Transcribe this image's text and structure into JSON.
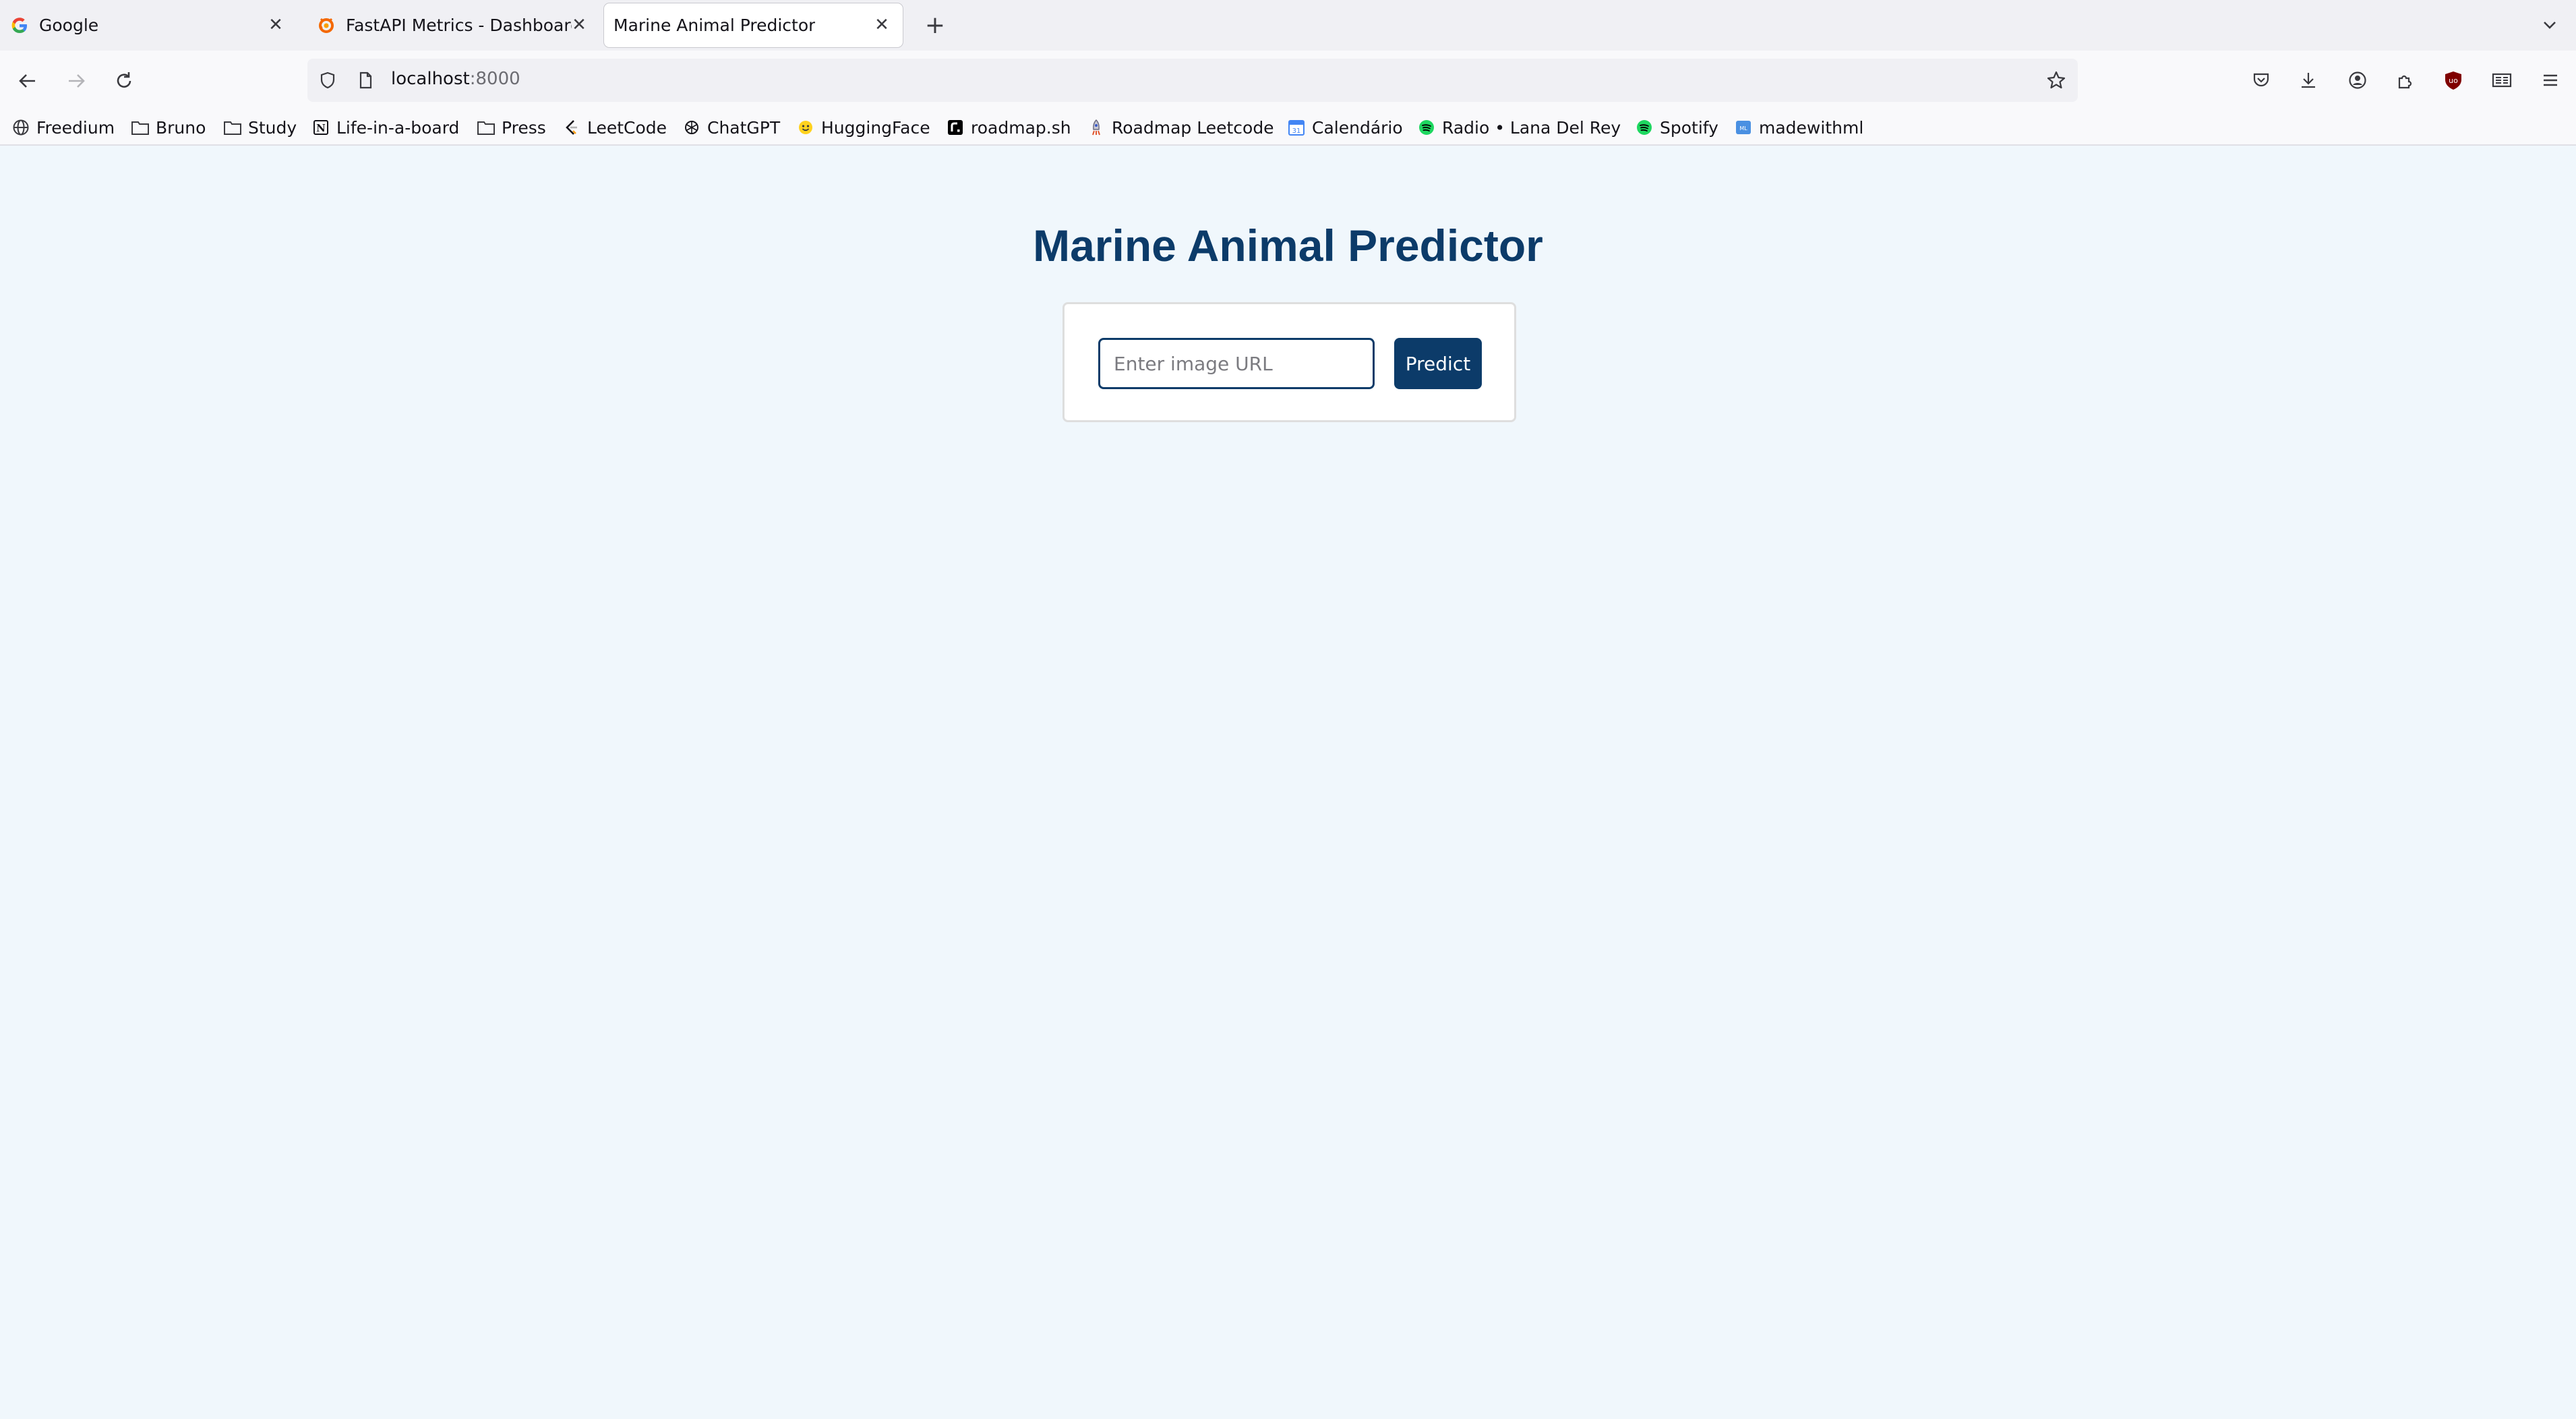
{
  "browser": {
    "tabs": [
      {
        "title": "Google",
        "favicon": "google-g-icon"
      },
      {
        "title": "FastAPI Metrics - Dashboard",
        "favicon": "grafana-icon"
      },
      {
        "title": "Marine Animal Predictor",
        "favicon": "none"
      }
    ],
    "url": {
      "host": "localhost",
      "port": ":8000"
    },
    "bookmarks": [
      {
        "label": "Freedium",
        "icon": "globe-icon"
      },
      {
        "label": "Bruno",
        "icon": "folder-icon"
      },
      {
        "label": "Study",
        "icon": "folder-icon"
      },
      {
        "label": "Life-in-a-board",
        "icon": "notion-icon"
      },
      {
        "label": "Press",
        "icon": "folder-icon"
      },
      {
        "label": "LeetCode",
        "icon": "leetcode-icon"
      },
      {
        "label": "ChatGPT",
        "icon": "openai-icon"
      },
      {
        "label": "HuggingFace",
        "icon": "huggingface-icon"
      },
      {
        "label": "roadmap.sh",
        "icon": "roadmap-icon"
      },
      {
        "label": "Roadmap Leetcode",
        "icon": "rocket-icon"
      },
      {
        "label": "Calendário",
        "icon": "calendar-icon"
      },
      {
        "label": "Radio • Lana Del Rey",
        "icon": "spotify-icon"
      },
      {
        "label": "Spotify",
        "icon": "spotify-icon"
      },
      {
        "label": "madewithml",
        "icon": "madewithml-icon"
      }
    ],
    "colors": {
      "accent": "#0c3b69",
      "page_bg": "#f0f7fc",
      "spotify": "#1ed760",
      "ublock": "#800000"
    }
  },
  "page": {
    "title": "Marine Animal Predictor",
    "input_placeholder": "Enter image URL",
    "input_value": "",
    "predict_label": "Predict"
  }
}
